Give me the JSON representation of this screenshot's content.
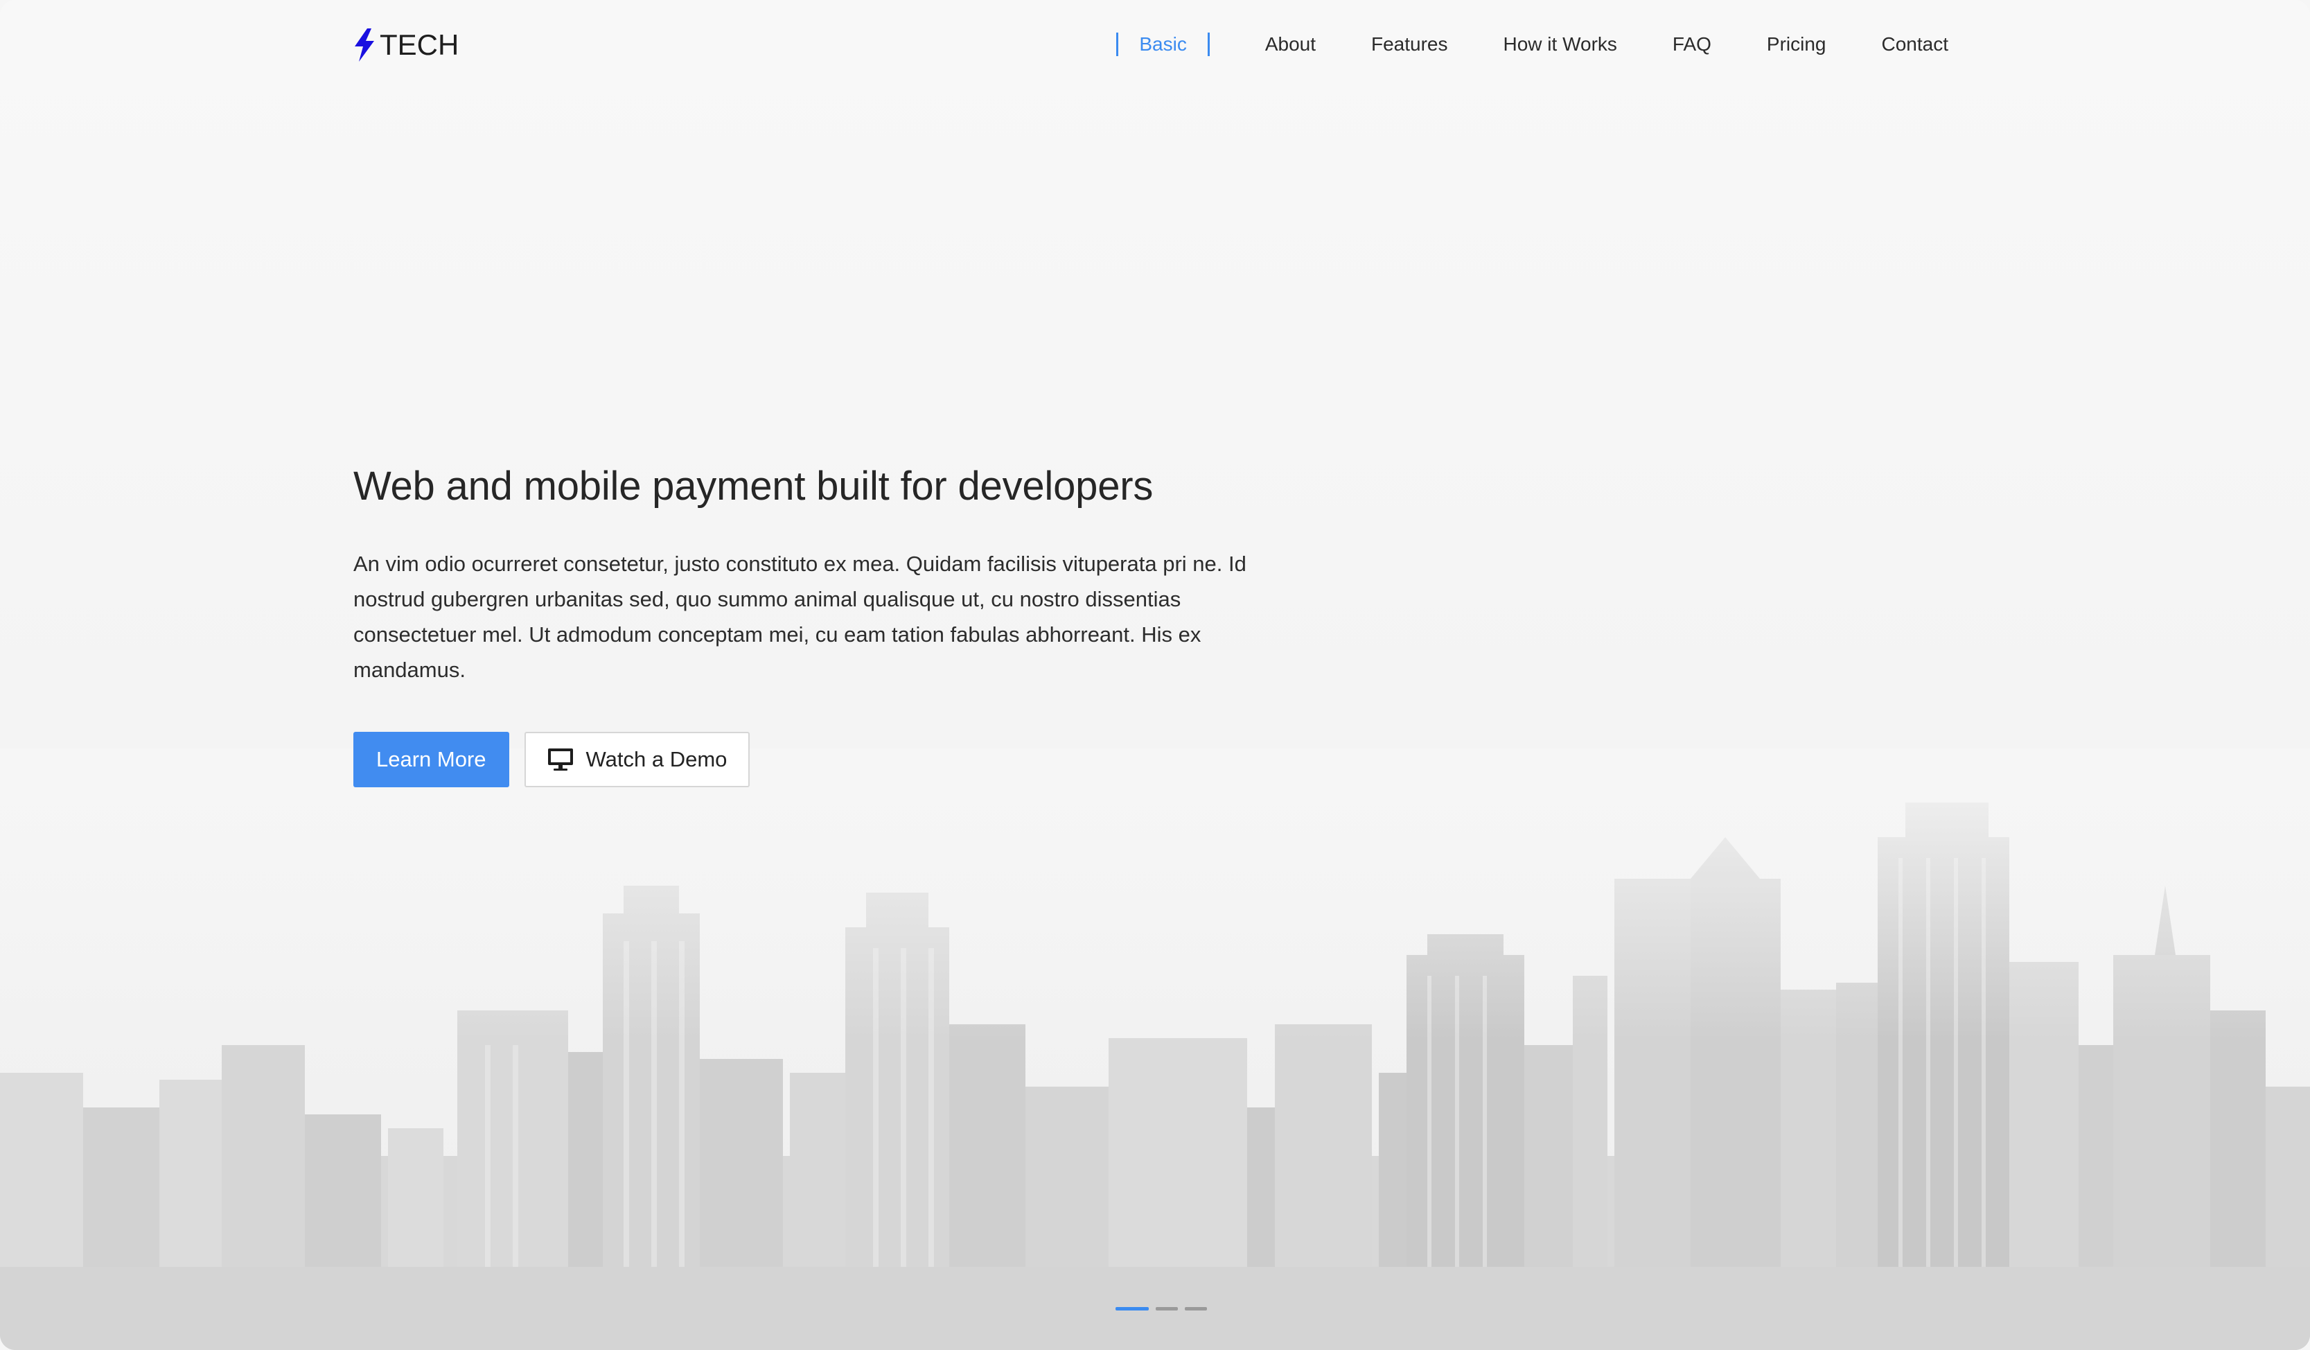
{
  "brand": {
    "logo_text": "TECH",
    "accent": "#3b8bf0",
    "logo_color": "#1a10e0"
  },
  "nav": {
    "items": [
      {
        "label": "Basic",
        "active": true
      },
      {
        "label": "About"
      },
      {
        "label": "Features"
      },
      {
        "label": "How it Works"
      },
      {
        "label": "FAQ"
      },
      {
        "label": "Pricing"
      },
      {
        "label": "Contact"
      }
    ]
  },
  "hero": {
    "title": "Web and mobile payment built for developers",
    "description": "An vim odio ocurreret consetetur, justo constituto ex mea. Quidam facilisis vituperata pri ne. Id nostrud gubergren urbanitas sed, quo summo animal qualisque ut, cu nostro dissentias consectetuer mel. Ut admodum conceptam mei, cu eam tation fabulas abhorreant. His ex mandamus.",
    "primary_button": "Learn More",
    "secondary_button": "Watch a Demo",
    "secondary_icon": "monitor-icon"
  },
  "carousel": {
    "slides": 3,
    "active_index": 0
  }
}
